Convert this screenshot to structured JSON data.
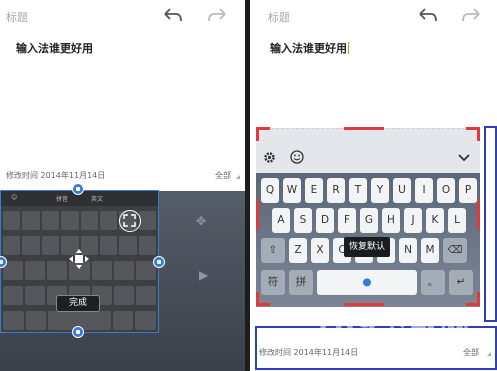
{
  "left": {
    "title_placeholder": "标题",
    "body_text": "输入法谁更好用",
    "meta_time": "修改时间 2014年11月14日",
    "meta_all": "全部",
    "toolbar_labels": [
      "拼音",
      "英文"
    ],
    "done_label": "完成"
  },
  "right": {
    "title_placeholder": "标题",
    "body_text": "输入法谁更好用",
    "meta_time": "修改时间 2014年11月14日",
    "meta_all": "全部",
    "row1": [
      "Q",
      "W",
      "E",
      "R",
      "T",
      "Y",
      "U",
      "I",
      "O",
      "P"
    ],
    "row2": [
      "A",
      "S",
      "D",
      "F",
      "G",
      "H",
      "J",
      "K",
      "L"
    ],
    "row3": [
      "Z",
      "X",
      "C",
      "V",
      "B",
      "N",
      "M"
    ],
    "bottom_left": "符",
    "bottom_pinyin": "拼",
    "restore_label": "恢复默认"
  },
  "watermark": {
    "main": "189下载网",
    "sub": "189d.com"
  },
  "colors": {
    "accent_blue": "#3a7bd5",
    "annot_blue": "#2f3fb5",
    "annot_red": "#e03a3a",
    "caret": "#d88a2c"
  },
  "icons": [
    "undo-icon",
    "redo-icon",
    "gear-icon",
    "smile-icon",
    "chevron-down-icon",
    "move-icon",
    "resize-icon",
    "backspace-icon",
    "shift-icon",
    "mic-icon"
  ]
}
